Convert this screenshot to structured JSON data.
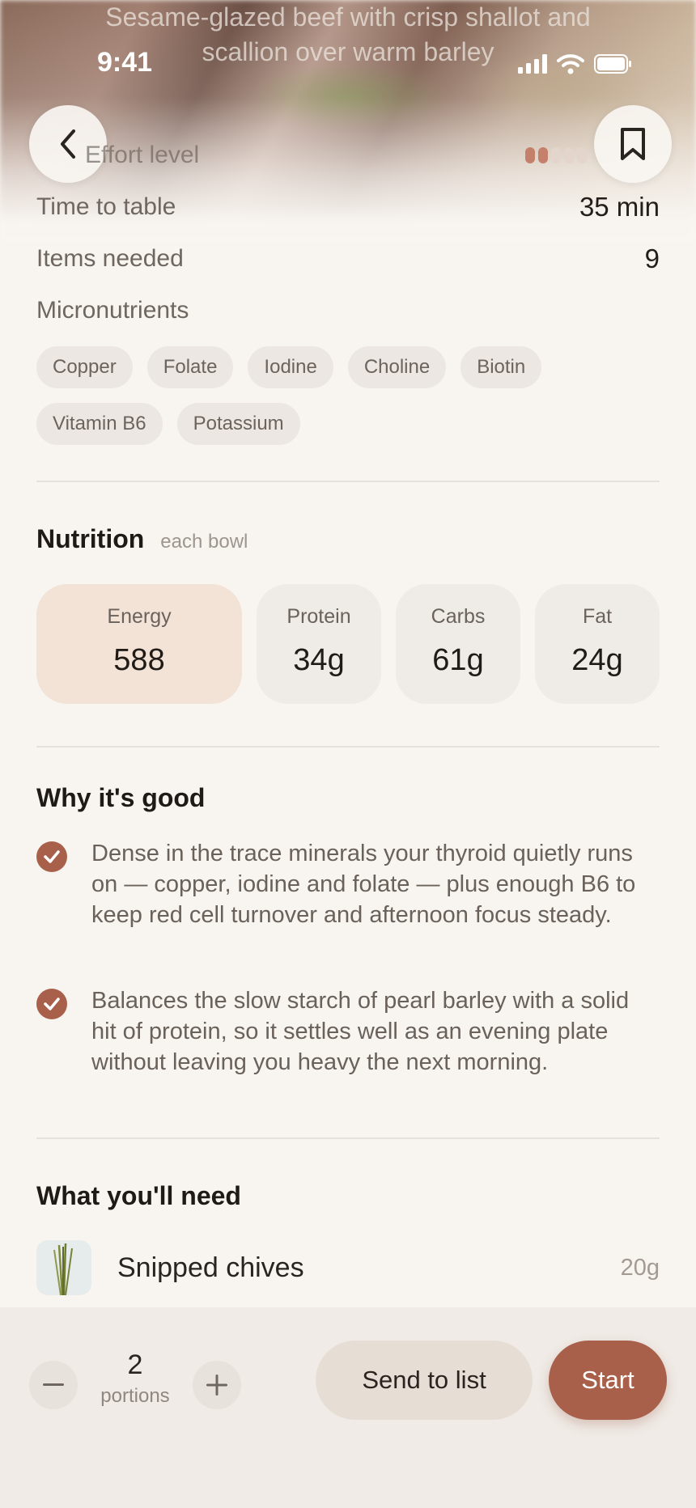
{
  "hero": {
    "title_line1": "Sesame-glazed beef with crisp shallot and",
    "title_line2": "scallion over warm barley"
  },
  "status_bar": {
    "time": "9:41"
  },
  "nav": {
    "back_icon": "chevron-left-icon",
    "bookmark_icon": "bookmark-icon"
  },
  "facts": {
    "effort_label": "Effort level",
    "effort_level": 2,
    "effort_max": 5,
    "time_label": "Time to table",
    "time_value": "35 min",
    "items_label": "Items needed",
    "items_value": "9",
    "micronutrients_label": "Micronutrients",
    "micronutrients": [
      "Copper",
      "Folate",
      "Iodine",
      "Choline",
      "Biotin",
      "Vitamin B6",
      "Potassium"
    ]
  },
  "nutrition": {
    "title": "Nutrition",
    "subtitle": "each bowl",
    "items": [
      {
        "label": "Energy",
        "value": "588"
      },
      {
        "label": "Protein",
        "value": "34g"
      },
      {
        "label": "Carbs",
        "value": "61g"
      },
      {
        "label": "Fat",
        "value": "24g"
      }
    ]
  },
  "why": {
    "title": "Why it's good",
    "points": [
      "Dense in the trace minerals your thyroid quietly runs on — copper, iodine and folate — plus enough B6 to keep red cell turnover and afternoon focus steady.",
      "Balances the slow starch of pearl barley with a solid hit of protein, so it settles well as an evening plate without leaving you heavy the next morning."
    ]
  },
  "ingredients": {
    "title": "What you'll need",
    "items": [
      {
        "name": "Snipped chives",
        "qty": "20g"
      }
    ]
  },
  "footer": {
    "portions_value": "2",
    "portions_label": "portions",
    "send_label": "Send to list",
    "start_label": "Start"
  },
  "colors": {
    "accent": "#a9604a",
    "energy_tile": "#f3e3d7",
    "background": "#f8f5f1"
  }
}
